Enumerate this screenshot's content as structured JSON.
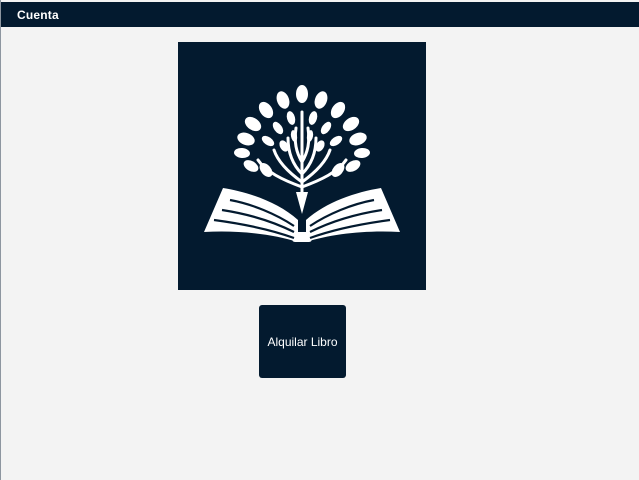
{
  "window": {
    "title": "Cuenta"
  },
  "logo": {
    "icon": "tree-book-icon",
    "background_color": "#031a2f",
    "foreground_color": "#ffffff"
  },
  "actions": {
    "rent_book_label": "Alquilar Libro"
  },
  "colors": {
    "accent": "#031a2f",
    "background": "#f3f3f3"
  }
}
